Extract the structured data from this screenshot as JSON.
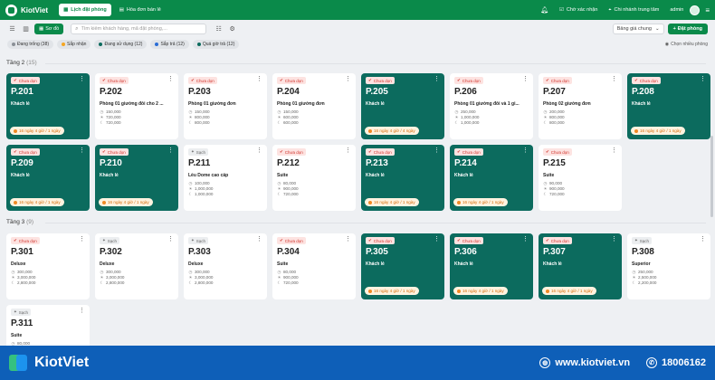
{
  "app": {
    "brand": "KiotViet"
  },
  "nav": {
    "tabs": [
      {
        "label": "Lịch đặt phòng",
        "active": true
      },
      {
        "label": "Hóa đơn bán lẻ",
        "active": false
      }
    ],
    "right": {
      "checkin_label": "Chờ xác nhận",
      "branch_label": "Chi nhánh trung tâm",
      "user_label": "admin"
    }
  },
  "toolbar": {
    "view_label": "Sơ đồ",
    "search_placeholder": "Tìm kiếm khách hàng, mã đặt phòng,...",
    "price_select": "Bảng giá chung",
    "add_label": "Đặt phòng"
  },
  "filters": [
    {
      "label": "Đang trống (38)",
      "color": "#8a8f96"
    },
    {
      "label": "Sắp nhận",
      "color": "#f5a623"
    },
    {
      "label": "Đang sử dụng (12)",
      "color": "#0c6b5e"
    },
    {
      "label": "Sắp trả (12)",
      "color": "#2a6dd6"
    },
    {
      "label": "Quá giờ trả (12)",
      "color": "#0c6b5e"
    }
  ],
  "select_many_label": "Chọn nhiều phòng",
  "floors": [
    {
      "name": "Tầng 2",
      "count": "(15)",
      "rooms": [
        {
          "no": "P.201",
          "status": "Chưa dọn",
          "occupied": true,
          "guest": "Khách lẻ",
          "stay": "16 ngày 4 giờ / 1 ngày"
        },
        {
          "no": "P.202",
          "status": "Chưa dọn",
          "occupied": false,
          "type": "Phòng 01 giường đôi cho 2 ...",
          "prices": [
            "150,000",
            "720,000",
            "720,000"
          ]
        },
        {
          "no": "P.203",
          "status": "Chưa dọn",
          "occupied": false,
          "type": "Phòng 01 giường đơn",
          "prices": [
            "150,000",
            "800,000",
            "800,000"
          ]
        },
        {
          "no": "P.204",
          "status": "Chưa dọn",
          "occupied": false,
          "type": "Phòng 01 giường đơn",
          "prices": [
            "150,000",
            "600,000",
            "600,000"
          ]
        },
        {
          "no": "P.205",
          "status": "Chưa dọn",
          "occupied": true,
          "guest": "Khách lẻ",
          "stay": "16 ngày 4 giờ / 4 ngày"
        },
        {
          "no": "P.206",
          "status": "Chưa dọn",
          "occupied": false,
          "type": "Phòng 01 giường đôi và 1 gi...",
          "prices": [
            "250,000",
            "1,000,000",
            "1,000,000"
          ]
        },
        {
          "no": "P.207",
          "status": "Chưa dọn",
          "occupied": false,
          "type": "Phòng 02 giường đơn",
          "prices": [
            "200,000",
            "800,000",
            "800,000"
          ]
        },
        {
          "no": "P.208",
          "status": "Chưa dọn",
          "occupied": true,
          "guest": "Khách lẻ",
          "stay": "16 ngày 4 giờ / 1 ngày"
        },
        {
          "no": "P.209",
          "status": "Chưa dọn",
          "occupied": true,
          "guest": "Khách lẻ",
          "stay": "16 ngày 4 giờ / 1 ngày"
        },
        {
          "no": "P.210",
          "status": "Chưa dọn",
          "occupied": true,
          "guest": "Khách lẻ",
          "stay": "16 ngày 4 giờ / 1 ngày"
        },
        {
          "no": "P.211",
          "status": "Sạch",
          "occupied": false,
          "type": "Lều Dome cao cấp",
          "prices": [
            "100,000",
            "1,000,000",
            "1,000,000"
          ]
        },
        {
          "no": "P.212",
          "status": "Chưa dọn",
          "occupied": false,
          "type": "Suite",
          "prices": [
            "80,000",
            "900,000",
            "720,000"
          ]
        },
        {
          "no": "P.213",
          "status": "Chưa dọn",
          "occupied": true,
          "guest": "Khách lẻ",
          "stay": "16 ngày 4 giờ / 1 ngày"
        },
        {
          "no": "P.214",
          "status": "Chưa dọn",
          "occupied": true,
          "guest": "Khách lẻ",
          "stay": "16 ngày 4 giờ / 1 ngày"
        },
        {
          "no": "P.215",
          "status": "Chưa dọn",
          "occupied": false,
          "type": "Suite",
          "prices": [
            "90,000",
            "900,000",
            "720,000"
          ]
        }
      ]
    },
    {
      "name": "Tầng 3",
      "count": "(9)",
      "rooms": [
        {
          "no": "P.301",
          "status": "Chưa dọn",
          "occupied": false,
          "type": "Deluxe",
          "prices": [
            "300,000",
            "3,000,000",
            "2,800,000"
          ]
        },
        {
          "no": "P.302",
          "status": "Sạch",
          "occupied": false,
          "type": "Deluxe",
          "prices": [
            "300,000",
            "3,000,000",
            "2,800,000"
          ]
        },
        {
          "no": "P.303",
          "status": "Sạch",
          "occupied": false,
          "type": "Deluxe",
          "prices": [
            "300,000",
            "3,000,000",
            "2,800,000"
          ]
        },
        {
          "no": "P.304",
          "status": "Chưa dọn",
          "occupied": false,
          "type": "Suite",
          "prices": [
            "80,000",
            "900,000",
            "720,000"
          ]
        },
        {
          "no": "P.305",
          "status": "Chưa dọn",
          "occupied": true,
          "guest": "Khách lẻ",
          "stay": "16 ngày 4 giờ / 1 ngày"
        },
        {
          "no": "P.306",
          "status": "Chưa dọn",
          "occupied": true,
          "guest": "Khách lẻ",
          "stay": "16 ngày 4 giờ / 1 ngày"
        },
        {
          "no": "P.307",
          "status": "Chưa dọn",
          "occupied": true,
          "guest": "Khách lẻ",
          "stay": "16 ngày 4 giờ / 1 ngày"
        },
        {
          "no": "P.308",
          "status": "Sạch",
          "occupied": false,
          "type": "Superior",
          "prices": [
            "250,000",
            "2,500,000",
            "2,200,000"
          ]
        },
        {
          "no": "P.311",
          "status": "Sạch",
          "occupied": false,
          "type": "Suite",
          "prices": [
            "80,000"
          ]
        }
      ]
    }
  ],
  "footer": {
    "brand": "KiotViet",
    "website": "www.kiotviet.vn",
    "phone": "18006162"
  },
  "colors": {
    "primary": "#0a8a4a",
    "occupied": "#0c6b5e",
    "footer": "#0e5fb8"
  }
}
